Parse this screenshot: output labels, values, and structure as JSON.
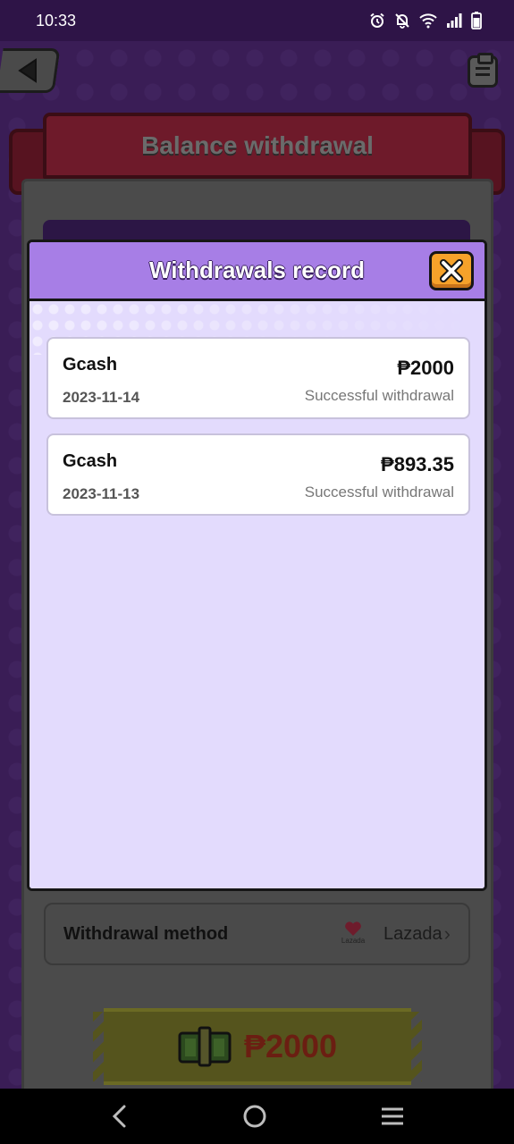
{
  "status_bar": {
    "time": "10:33",
    "icons": [
      "alarm-icon",
      "notifications-off-icon",
      "wifi-icon",
      "signal-icon",
      "battery-icon"
    ]
  },
  "background_screen": {
    "banner_title": "Balance withdrawal",
    "withdrawal_method": {
      "label": "Withdrawal method",
      "value": "Lazada",
      "logo_text": "Lazada"
    },
    "amount": "₱2000"
  },
  "modal": {
    "title": "Withdrawals record",
    "close_label": "X",
    "records": [
      {
        "method": "Gcash",
        "date": "2023-11-14",
        "amount": "₱2000",
        "status": "Successful withdrawal"
      },
      {
        "method": "Gcash",
        "date": "2023-11-13",
        "amount": "₱893.35",
        "status": "Successful withdrawal"
      }
    ]
  },
  "nav_bar": {
    "buttons": [
      "back-nav-icon",
      "home-nav-icon",
      "recents-nav-icon"
    ]
  },
  "colors": {
    "modal_header": "#a77ee6",
    "modal_body": "#e3dbfd",
    "close_button": "#f6a22a"
  }
}
